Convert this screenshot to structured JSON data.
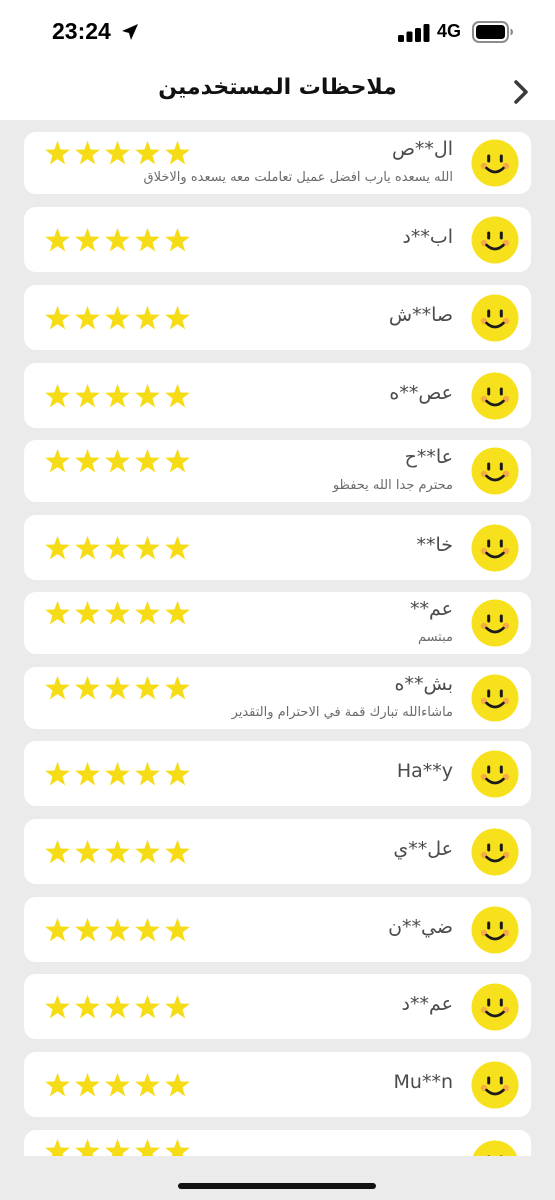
{
  "status_bar": {
    "time": "23:24",
    "network": "4G"
  },
  "header": {
    "title": "ملاحظات المستخدمين"
  },
  "colors": {
    "star": "#f5dc16",
    "avatar": "#f7e11c",
    "cheek": "#f5a24e"
  },
  "reviews": [
    {
      "name": "ال**ص",
      "comment": "الله يسعده يارب افضل عميل تعاملت معه يسعده والاخلاق",
      "rating": 5
    },
    {
      "name": "اب**د",
      "comment": "",
      "rating": 5
    },
    {
      "name": "صا**ش",
      "comment": "",
      "rating": 5
    },
    {
      "name": "عص**ه",
      "comment": "",
      "rating": 5
    },
    {
      "name": "عا**ح",
      "comment": "محترم جدا الله يحفظو",
      "rating": 5
    },
    {
      "name": "خا**",
      "comment": "",
      "rating": 5
    },
    {
      "name": "عم**",
      "comment": "مبتسم",
      "rating": 5
    },
    {
      "name": "بش**ه",
      "comment": "ماشاءالله تبارك قمة في الاحترام والتقدير",
      "rating": 5
    },
    {
      "name": "Ha**y",
      "comment": "",
      "rating": 5
    },
    {
      "name": "عل**ي",
      "comment": "",
      "rating": 5
    },
    {
      "name": "ضي**ن",
      "comment": "",
      "rating": 5
    },
    {
      "name": "عم**د",
      "comment": "",
      "rating": 5
    },
    {
      "name": "Mu**n",
      "comment": "",
      "rating": 5
    },
    {
      "name": "",
      "comment": "",
      "rating": 5
    }
  ]
}
